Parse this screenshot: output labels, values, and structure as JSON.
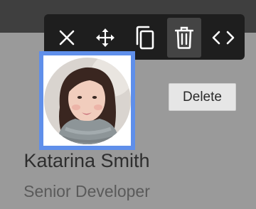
{
  "toolbar": {
    "buttons": [
      {
        "icon": "close-icon"
      },
      {
        "icon": "move-icon"
      },
      {
        "icon": "duplicate-icon"
      },
      {
        "icon": "delete-icon",
        "active": true
      },
      {
        "icon": "code-icon"
      }
    ]
  },
  "tooltip": {
    "text": "Delete"
  },
  "profile": {
    "name": "Katarina Smith",
    "role": "Senior Developer"
  },
  "colors": {
    "toolbar_bg": "#1e1e1e",
    "active_button_bg": "#444444",
    "selection_border": "#5f8fea",
    "canvas_bg": "#9a9a9a",
    "top_bar": "#3f3f3f"
  }
}
